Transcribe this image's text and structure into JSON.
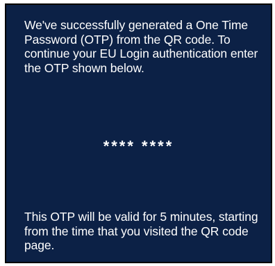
{
  "panel": {
    "background_color": "#0c2146",
    "text_color": "#ffffff",
    "intro_text": "We've successfully generated a One Time Password (OTP) from the QR code. To continue your EU Login authentication enter the OTP shown below.",
    "otp_masked": "**** ****",
    "validity_text": "This OTP will be valid for 5 minutes, starting from the time that you visited the QR code page."
  }
}
